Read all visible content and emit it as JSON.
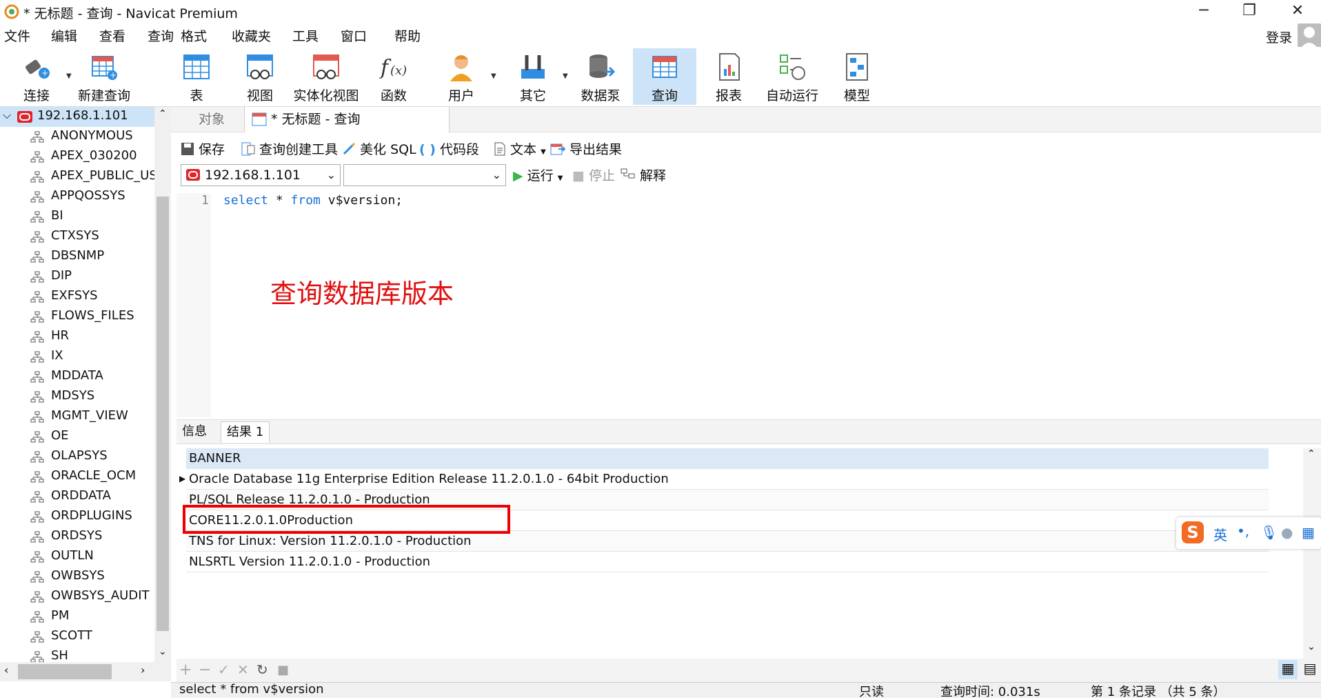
{
  "window": {
    "title": "* 无标题 - 查询 - Navicat Premium"
  },
  "menu": {
    "items": [
      "文件",
      "编辑",
      "查看",
      "查询",
      "格式",
      "收藏夹",
      "工具",
      "窗口",
      "帮助"
    ],
    "login": "登录"
  },
  "toolbar": {
    "items": [
      "连接",
      "新建查询",
      "表",
      "视图",
      "实体化视图",
      "函数",
      "用户",
      "其它",
      "数据泵",
      "查询",
      "报表",
      "自动运行",
      "模型"
    ],
    "active": "查询"
  },
  "tree": {
    "root": "192.168.1.101",
    "schemas": [
      "ANONYMOUS",
      "APEX_030200",
      "APEX_PUBLIC_USER",
      "APPQOSSYS",
      "BI",
      "CTXSYS",
      "DBSNMP",
      "DIP",
      "EXFSYS",
      "FLOWS_FILES",
      "HR",
      "IX",
      "MDDATA",
      "MDSYS",
      "MGMT_VIEW",
      "OE",
      "OLAPSYS",
      "ORACLE_OCM",
      "ORDDATA",
      "ORDPLUGINS",
      "ORDSYS",
      "OUTLN",
      "OWBSYS",
      "OWBSYS_AUDIT",
      "PM",
      "SCOTT",
      "SH"
    ]
  },
  "tabs": {
    "objects": "对象",
    "query": "* 无标题 - 查询"
  },
  "query_toolbar": {
    "save": "保存",
    "builder": "查询创建工具",
    "beautify": "美化 SQL",
    "snippet": "代码段",
    "text": "文本",
    "export": "导出结果",
    "connection": "192.168.1.101",
    "schema": "",
    "run": "运行",
    "stop": "停止",
    "explain": "解释"
  },
  "editor": {
    "line_no": "1",
    "code_kw1": "select",
    "code_star": " * ",
    "code_kw2": "from",
    "code_rest": " v$version;"
  },
  "annotation": "查询数据库版本",
  "results": {
    "tabs": [
      "信息",
      "结果 1"
    ],
    "column": "BANNER",
    "rows": [
      "Oracle Database 11g Enterprise Edition Release 11.2.0.1.0 - 64bit Production",
      "PL/SQL Release 11.2.0.1.0 - Production",
      "CORE11.2.0.1.0Production",
      "TNS for Linux: Version 11.2.0.1.0 - Production",
      "NLSRTL Version 11.2.0.1.0 - Production"
    ]
  },
  "ime": {
    "lang": "英",
    "punct": "•,"
  },
  "status": {
    "sql": "select * from v$version",
    "mode": "只读",
    "time": "查询时间: 0.031s",
    "records": "第 1 条记录 （共 5 条）"
  },
  "colors": {
    "accent": "#cde3f7",
    "annotation": "#e01010",
    "highlight_box": "#ee0000",
    "oracle_red": "#e0242b"
  }
}
